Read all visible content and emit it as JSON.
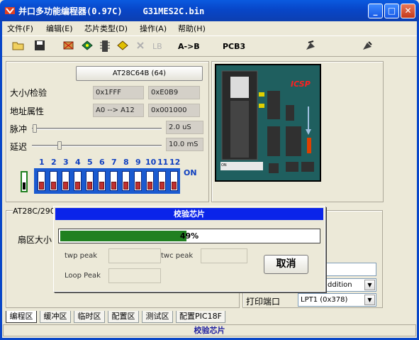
{
  "window": {
    "title": "并口多功能编程器(0.97C)    G31MES2C.bin",
    "min": "_",
    "max": "□",
    "close": "✕"
  },
  "menu": [
    {
      "label": "文件(F)"
    },
    {
      "label": "编辑(E)"
    },
    {
      "label": "芯片类型(D)"
    },
    {
      "label": "操作(A)"
    },
    {
      "label": "帮助(H)"
    }
  ],
  "toolbar": {
    "lb": "LB",
    "a_to_b": "A->B",
    "pcb3": "PCB3"
  },
  "chip": {
    "name": "AT28C64B    (64)",
    "size_label": "大小/检验",
    "size_value": "0x1FFF",
    "checksum": "0xE0B9",
    "addr_label": "地址属性",
    "addr_range": "A0 --> A12",
    "addr_value": "0x001000",
    "pulse_label": "脉冲",
    "pulse_value": "2.0 uS",
    "delay_label": "延迟",
    "delay_value": "10.0 mS"
  },
  "dip": {
    "numbers": [
      "1",
      "2",
      "3",
      "4",
      "5",
      "6",
      "7",
      "8",
      "9",
      "10",
      "11",
      "12"
    ],
    "on_label": "ON"
  },
  "board": {
    "icsp_label": "ICSP",
    "strip_label": "ON"
  },
  "lower": {
    "group_label": "AT28C/290",
    "sector_label": "扇区大小",
    "mode_value": "ddition",
    "printer_label": "打印端口",
    "printer_value": "LPT1 (0x378)"
  },
  "dialog": {
    "title": "校验芯片",
    "progress_text": "49%",
    "progress": 0.49,
    "twp_label": "twp peak",
    "twc_label": "twc peak",
    "loop_label": "Loop Peak",
    "cancel": "取消"
  },
  "tabs": [
    {
      "label": "编程区",
      "active": true
    },
    {
      "label": "缓冲区"
    },
    {
      "label": "临时区"
    },
    {
      "label": "配置区"
    },
    {
      "label": "测试区"
    },
    {
      "label": "配置PIC18F"
    }
  ],
  "status": {
    "text": "校验芯片"
  },
  "colors": {
    "progress": "#208020",
    "dialog_title": "#0a24ea",
    "dip": "#1a5ad0"
  }
}
